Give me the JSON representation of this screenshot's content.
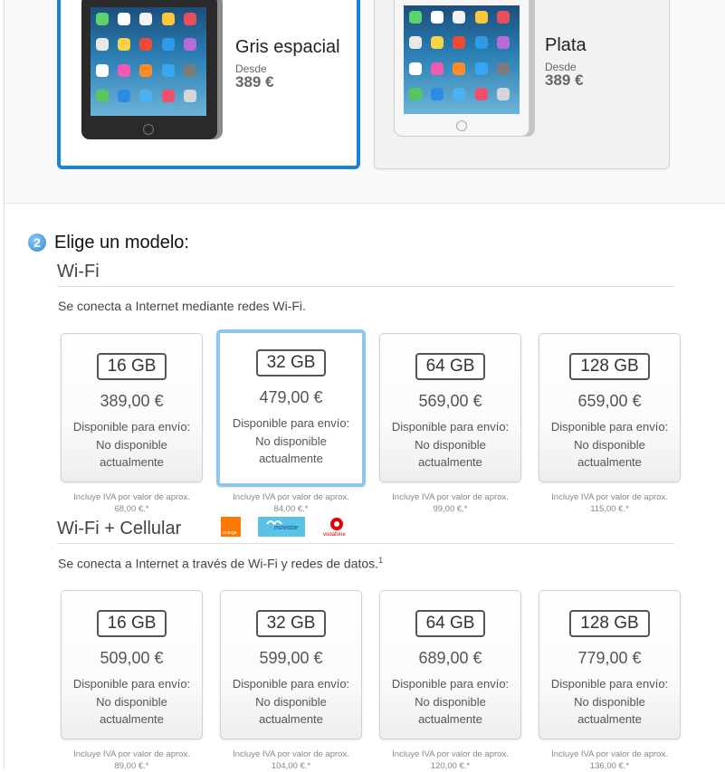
{
  "colors": [
    {
      "name": "Gris espacial",
      "desde": "Desde",
      "price": "389 €"
    },
    {
      "name": "Plata",
      "desde": "Desde",
      "price": "389 €"
    }
  ],
  "step": {
    "number": "2",
    "title": "Elige un modelo:"
  },
  "wifi": {
    "title": "Wi-Fi",
    "description": "Se conecta a Internet mediante redes Wi-Fi.",
    "models": [
      {
        "capacity": "16 GB",
        "price": "389,00 €",
        "availability_label": "Disponible para envío:",
        "availability_value": "No disponible actualmente",
        "tax_line1": "Incluye IVA por valor de aprox.",
        "tax_line2": "68,00 €.*"
      },
      {
        "capacity": "32 GB",
        "price": "479,00 €",
        "availability_label": "Disponible para envío:",
        "availability_value": "No disponible actualmente",
        "tax_line1": "Incluye IVA por valor de aprox.",
        "tax_line2": "84,00 €.*",
        "selected": true
      },
      {
        "capacity": "64 GB",
        "price": "569,00 €",
        "availability_label": "Disponible para envío:",
        "availability_value": "No disponible actualmente",
        "tax_line1": "Incluye IVA por valor de aprox.",
        "tax_line2": "99,00 €.*"
      },
      {
        "capacity": "128 GB",
        "price": "659,00 €",
        "availability_label": "Disponible para envío:",
        "availability_value": "No disponible actualmente",
        "tax_line1": "Incluye IVA por valor de aprox.",
        "tax_line2": "115,00 €.*"
      }
    ]
  },
  "cellular": {
    "title": "Wi-Fi + Cellular",
    "description": "Se conecta a Internet a través de Wi-Fi y redes de datos.",
    "footnote": "1",
    "carriers": [
      "orange",
      "movistar",
      "vodafone"
    ],
    "models": [
      {
        "capacity": "16 GB",
        "price": "509,00 €",
        "availability_label": "Disponible para envío:",
        "availability_value": "No disponible actualmente",
        "tax_line1": "Incluye IVA por valor de aprox.",
        "tax_line2": "89,00 €.*"
      },
      {
        "capacity": "32 GB",
        "price": "599,00 €",
        "availability_label": "Disponible para envío:",
        "availability_value": "No disponible actualmente",
        "tax_line1": "Incluye IVA por valor de aprox.",
        "tax_line2": "104,00 €.*"
      },
      {
        "capacity": "64 GB",
        "price": "689,00 €",
        "availability_label": "Disponible para envío:",
        "availability_value": "No disponible actualmente",
        "tax_line1": "Incluye IVA por valor de aprox.",
        "tax_line2": "120,00 €.*"
      },
      {
        "capacity": "128 GB",
        "price": "779,00 €",
        "availability_label": "Disponible para envío:",
        "availability_value": "No disponible actualmente",
        "tax_line1": "Incluye IVA por valor de aprox.",
        "tax_line2": "136,00 €.*"
      }
    ]
  },
  "palette": {
    "selected_border": "#1a82d8",
    "selected_model_border": "#8fc6ea",
    "orange": "#ff7900",
    "movistar": "#5bc2e7",
    "vodafone": "#e60000"
  }
}
